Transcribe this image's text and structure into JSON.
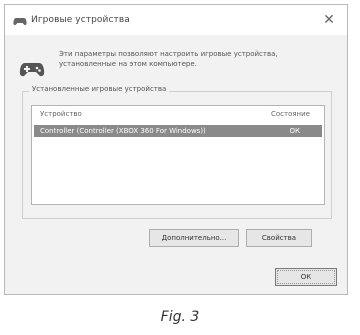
{
  "window": {
    "title": "Игровые устройства",
    "close_glyph": "✕"
  },
  "info": {
    "icon": "gamepad-icon",
    "text": "Эти параметры позволяют настроить игровые устройства, установленные на этом компьютере."
  },
  "devices": {
    "group_label": "Установленные игровые устройства",
    "columns": {
      "device": "Устройство",
      "status": "Состояние"
    },
    "rows": [
      {
        "device": "Controller (Controller (XBOX 360 For Windows))",
        "status": "ОК"
      }
    ]
  },
  "buttons": {
    "advanced": "Дополнительно...",
    "properties": "Свойства",
    "ok": "ОК"
  },
  "caption": "Fig. 3"
}
